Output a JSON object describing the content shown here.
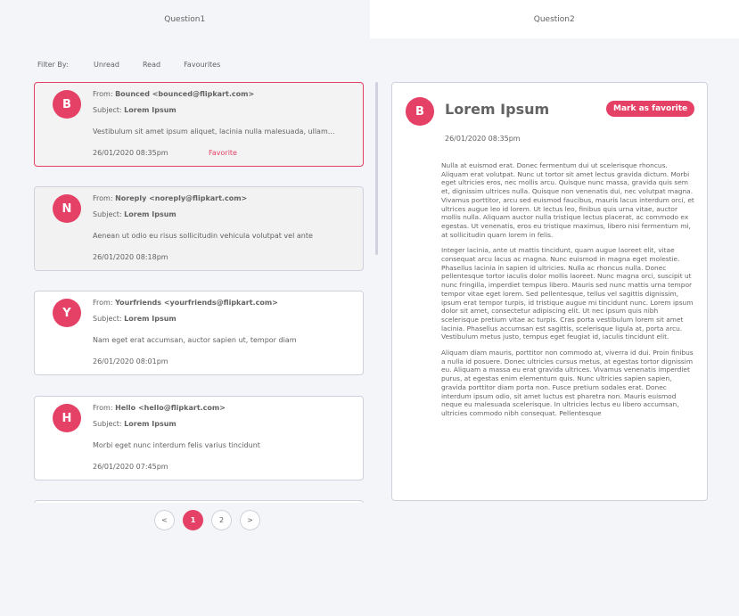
{
  "tabs": [
    {
      "label": "Question1"
    },
    {
      "label": "Question2"
    }
  ],
  "filter": {
    "label": "Filter By:",
    "options": [
      "Unread",
      "Read",
      "Favourites"
    ]
  },
  "emails": [
    {
      "initial": "B",
      "from_prefix": "From: ",
      "from": "Bounced <bounced@flipkart.com>",
      "subject_prefix": "Subject: ",
      "subject": "Lorem Ipsum",
      "preview": "Vestibulum sit amet ipsum aliquet, lacinia nulla malesuada, ullam...",
      "date": "26/01/2020 08:35pm",
      "favorite_label": "Favorite"
    },
    {
      "initial": "N",
      "from_prefix": "From: ",
      "from": "Noreply <noreply@flipkart.com>",
      "subject_prefix": "Subject: ",
      "subject": "Lorem Ipsum",
      "preview": "Aenean ut odio eu risus sollicitudin vehicula volutpat vel ante",
      "date": "26/01/2020 08:18pm"
    },
    {
      "initial": "Y",
      "from_prefix": "From: ",
      "from": "Yourfriends <yourfriends@flipkart.com>",
      "subject_prefix": "Subject: ",
      "subject": "Lorem Ipsum",
      "preview": "Nam eget erat accumsan, auctor sapien ut, tempor diam",
      "date": "26/01/2020 08:01pm"
    },
    {
      "initial": "H",
      "from_prefix": "From: ",
      "from": "Hello <hello@flipkart.com>",
      "subject_prefix": "Subject: ",
      "subject": "Lorem Ipsum",
      "preview": "Morbi eget nunc interdum felis varius tincidunt",
      "date": "26/01/2020 07:45pm"
    }
  ],
  "pagination": {
    "prev": "<",
    "pages": [
      "1",
      "2"
    ],
    "next": ">"
  },
  "detail": {
    "initial": "B",
    "title": "Lorem Ipsum",
    "favorite_button": "Mark as favorite",
    "date": "26/01/2020 08:35pm",
    "paragraphs": [
      "Nulla at euismod erat. Donec fermentum dui ut scelerisque rhoncus. Aliquam erat volutpat. Nunc ut tortor sit amet lectus gravida dictum. Morbi eget ultricies eros, nec mollis arcu. Quisque nunc massa, gravida quis sem et, dignissim ultrices nulla. Quisque non venenatis dui, nec volutpat magna. Vivamus porttitor, arcu sed euismod faucibus, mauris lacus interdum orci, et ultrices augue leo id lorem. Ut lectus leo, finibus quis urna vitae, auctor mollis nulla. Aliquam auctor nulla tristique lectus placerat, ac commodo ex egestas. Ut venenatis, eros eu tristique maximus, libero nisi fermentum mi, at sollicitudin quam lorem in felis.",
      "Integer lacinia, ante ut mattis tincidunt, quam augue laoreet elit, vitae consequat arcu lacus ac magna. Nunc euismod in magna eget molestie. Phasellus lacinia in sapien id ultricies. Nulla ac rhoncus nulla. Donec pellentesque tortor iaculis dolor mollis laoreet. Nunc magna orci, suscipit ut nunc fringilla, imperdiet tempus libero. Mauris sed nunc mattis urna tempor tempor vitae eget lorem. Sed pellentesque, tellus vel sagittis dignissim, ipsum erat tempor turpis, id tristique augue mi tincidunt nunc. Lorem ipsum dolor sit amet, consectetur adipiscing elit. Ut nec ipsum quis nibh scelerisque pretium vitae ac turpis. Cras porta vestibulum lorem sit amet lacinia. Phasellus accumsan est sagittis, scelerisque ligula at, porta arcu. Vestibulum metus justo, tempus eget feugiat id, iaculis tincidunt elit.",
      "Aliquam diam mauris, porttitor non commodo at, viverra id dui. Proin finibus a nulla id posuere. Donec ultricies cursus metus, at egestas tortor dignissim eu. Aliquam a massa eu erat gravida ultrices. Vivamus venenatis imperdiet purus, at egestas enim elementum quis. Nunc ultricies sapien sapien, gravida porttitor diam porta non. Fusce pretium sodales erat. Donec interdum ipsum odio, sit amet luctus est pharetra non. Mauris euismod neque eu malesuada scelerisque. In ultricies lectus eu libero accumsan, ultricies commodo nibh consequat. Pellentesque"
    ]
  }
}
